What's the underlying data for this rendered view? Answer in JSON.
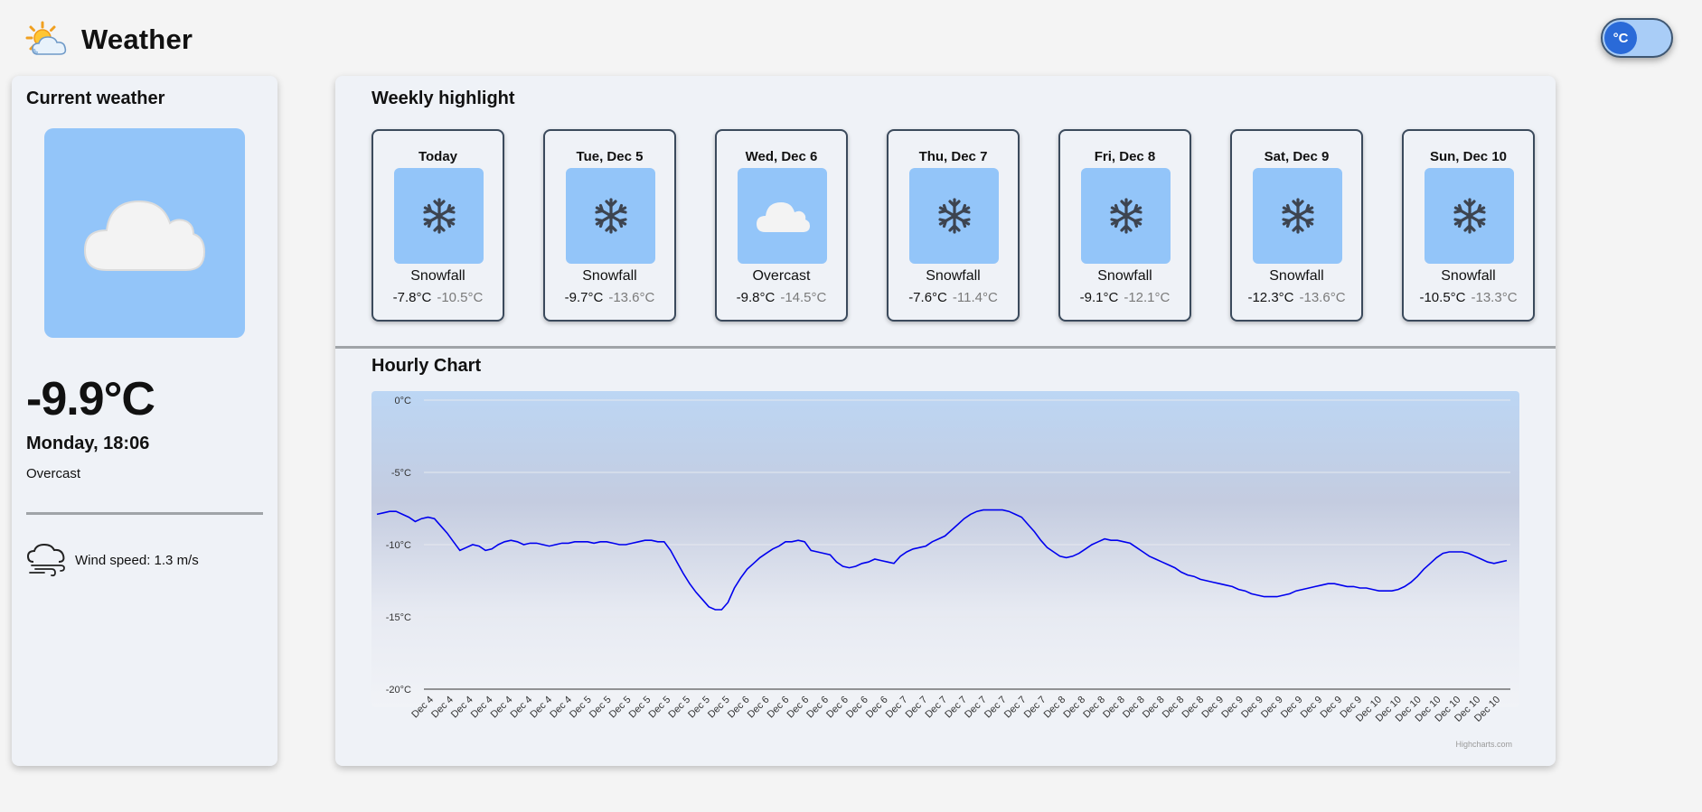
{
  "app": {
    "title": "Weather",
    "logo_icon": "sun-behind-cloud-icon"
  },
  "unit_toggle": {
    "label": "°C",
    "active_color": "#2a6ad8",
    "track_color": "#a9cdf7"
  },
  "current": {
    "section_title": "Current weather",
    "icon": "cloud-icon",
    "temperature": "-9.9°C",
    "date_time": "Monday, 18:06",
    "condition": "Overcast",
    "wind_icon": "wind-icon",
    "wind_label": "Wind speed: 1.3 m/s"
  },
  "weekly": {
    "section_title": "Weekly highlight",
    "days": [
      {
        "name": "Today",
        "icon": "snowflake-icon",
        "desc": "Snowfall",
        "max": "-7.8°C",
        "min": "-10.5°C"
      },
      {
        "name": "Tue, Dec 5",
        "icon": "snowflake-icon",
        "desc": "Snowfall",
        "max": "-9.7°C",
        "min": "-13.6°C"
      },
      {
        "name": "Wed, Dec 6",
        "icon": "cloud-icon",
        "desc": "Overcast",
        "max": "-9.8°C",
        "min": "-14.5°C"
      },
      {
        "name": "Thu, Dec 7",
        "icon": "snowflake-icon",
        "desc": "Snowfall",
        "max": "-7.6°C",
        "min": "-11.4°C"
      },
      {
        "name": "Fri, Dec 8",
        "icon": "snowflake-icon",
        "desc": "Snowfall",
        "max": "-9.1°C",
        "min": "-12.1°C"
      },
      {
        "name": "Sat, Dec 9",
        "icon": "snowflake-icon",
        "desc": "Snowfall",
        "max": "-12.3°C",
        "min": "-13.6°C"
      },
      {
        "name": "Sun, Dec 10",
        "icon": "snowflake-icon",
        "desc": "Snowfall",
        "max": "-10.5°C",
        "min": "-13.3°C"
      }
    ]
  },
  "hourly": {
    "section_title": "Hourly Chart",
    "credits": "Highcharts.com"
  },
  "chart_data": {
    "type": "line",
    "title": "",
    "xlabel": "",
    "ylabel": "",
    "ylim": [
      -20,
      0
    ],
    "yticks": [
      "0°C",
      "-5°C",
      "-10°C",
      "-15°C",
      "-20°C"
    ],
    "grid": true,
    "line_color": "#0000ee",
    "x_tick_labels": [
      "Dec 4",
      "Dec 4",
      "Dec 4",
      "Dec 4",
      "Dec 4",
      "Dec 4",
      "Dec 4",
      "Dec 4",
      "Dec 5",
      "Dec 5",
      "Dec 5",
      "Dec 5",
      "Dec 5",
      "Dec 5",
      "Dec 5",
      "Dec 5",
      "Dec 6",
      "Dec 6",
      "Dec 6",
      "Dec 6",
      "Dec 6",
      "Dec 6",
      "Dec 6",
      "Dec 6",
      "Dec 7",
      "Dec 7",
      "Dec 7",
      "Dec 7",
      "Dec 7",
      "Dec 7",
      "Dec 7",
      "Dec 7",
      "Dec 8",
      "Dec 8",
      "Dec 8",
      "Dec 8",
      "Dec 8",
      "Dec 8",
      "Dec 8",
      "Dec 8",
      "Dec 9",
      "Dec 9",
      "Dec 9",
      "Dec 9",
      "Dec 9",
      "Dec 9",
      "Dec 9",
      "Dec 9",
      "Dec 10",
      "Dec 10",
      "Dec 10",
      "Dec 10",
      "Dec 10",
      "Dec 10",
      "Dec 10"
    ],
    "values": [
      -7.9,
      -7.8,
      -7.7,
      -7.7,
      -7.9,
      -8.1,
      -8.4,
      -8.2,
      -8.1,
      -8.2,
      -8.7,
      -9.2,
      -9.8,
      -10.4,
      -10.2,
      -10.0,
      -10.1,
      -10.4,
      -10.3,
      -10.0,
      -9.8,
      -9.7,
      -9.8,
      -10.0,
      -9.9,
      -9.9,
      -10.0,
      -10.1,
      -10.0,
      -9.9,
      -9.9,
      -9.8,
      -9.8,
      -9.8,
      -9.9,
      -9.8,
      -9.8,
      -9.9,
      -10.0,
      -10.0,
      -9.9,
      -9.8,
      -9.7,
      -9.7,
      -9.8,
      -9.8,
      -10.4,
      -11.2,
      -12.0,
      -12.7,
      -13.3,
      -13.8,
      -14.3,
      -14.5,
      -14.5,
      -14.0,
      -13.0,
      -12.3,
      -11.7,
      -11.3,
      -10.9,
      -10.6,
      -10.3,
      -10.1,
      -9.8,
      -9.8,
      -9.7,
      -9.8,
      -10.4,
      -10.5,
      -10.6,
      -10.7,
      -11.2,
      -11.5,
      -11.6,
      -11.5,
      -11.3,
      -11.2,
      -11.0,
      -11.1,
      -11.2,
      -11.3,
      -10.8,
      -10.5,
      -10.3,
      -10.2,
      -10.1,
      -9.8,
      -9.6,
      -9.4,
      -9.0,
      -8.6,
      -8.2,
      -7.9,
      -7.7,
      -7.6,
      -7.6,
      -7.6,
      -7.6,
      -7.7,
      -7.9,
      -8.1,
      -8.6,
      -9.1,
      -9.7,
      -10.2,
      -10.5,
      -10.8,
      -10.9,
      -10.8,
      -10.6,
      -10.3,
      -10.0,
      -9.8,
      -9.6,
      -9.7,
      -9.7,
      -9.8,
      -9.9,
      -10.2,
      -10.5,
      -10.8,
      -11.0,
      -11.2,
      -11.4,
      -11.6,
      -11.9,
      -12.1,
      -12.2,
      -12.4,
      -12.5,
      -12.6,
      -12.7,
      -12.8,
      -12.9,
      -13.1,
      -13.2,
      -13.4,
      -13.5,
      -13.6,
      -13.6,
      -13.6,
      -13.5,
      -13.4,
      -13.2,
      -13.1,
      -13.0,
      -12.9,
      -12.8,
      -12.7,
      -12.7,
      -12.8,
      -12.9,
      -12.9,
      -13.0,
      -13.0,
      -13.1,
      -13.2,
      -13.2,
      -13.2,
      -13.1,
      -12.9,
      -12.6,
      -12.2,
      -11.7,
      -11.3,
      -10.9,
      -10.6,
      -10.5,
      -10.5,
      -10.5,
      -10.6,
      -10.8,
      -11.0,
      -11.2,
      -11.3,
      -11.2,
      -11.1
    ]
  }
}
